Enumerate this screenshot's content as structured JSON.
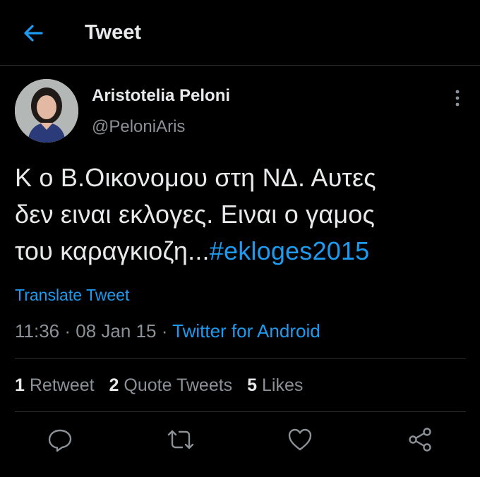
{
  "header": {
    "title": "Tweet",
    "back_icon": "arrow-left-icon",
    "accent": "#1d9bf0"
  },
  "tweet": {
    "author_name": "Aristotelia Peloni",
    "handle": "@PeloniAris",
    "text_lines": [
      "Κ ο Β.Οικονομου στη ΝΔ. Αυτες",
      "δεν ειναι εκλογες. Ειναι ο γαμος",
      "του καραγκιοζη..."
    ],
    "hashtag": "#ekloges2015",
    "translate_label": "Translate Tweet",
    "time": "11:36",
    "date": "08 Jan 15",
    "source": "Twitter for Android"
  },
  "stats": [
    {
      "count": "1",
      "label": "Retweet"
    },
    {
      "count": "2",
      "label": "Quote Tweets"
    },
    {
      "count": "5",
      "label": "Likes"
    }
  ],
  "actions": [
    "reply-icon",
    "retweet-icon",
    "like-icon",
    "share-icon"
  ]
}
